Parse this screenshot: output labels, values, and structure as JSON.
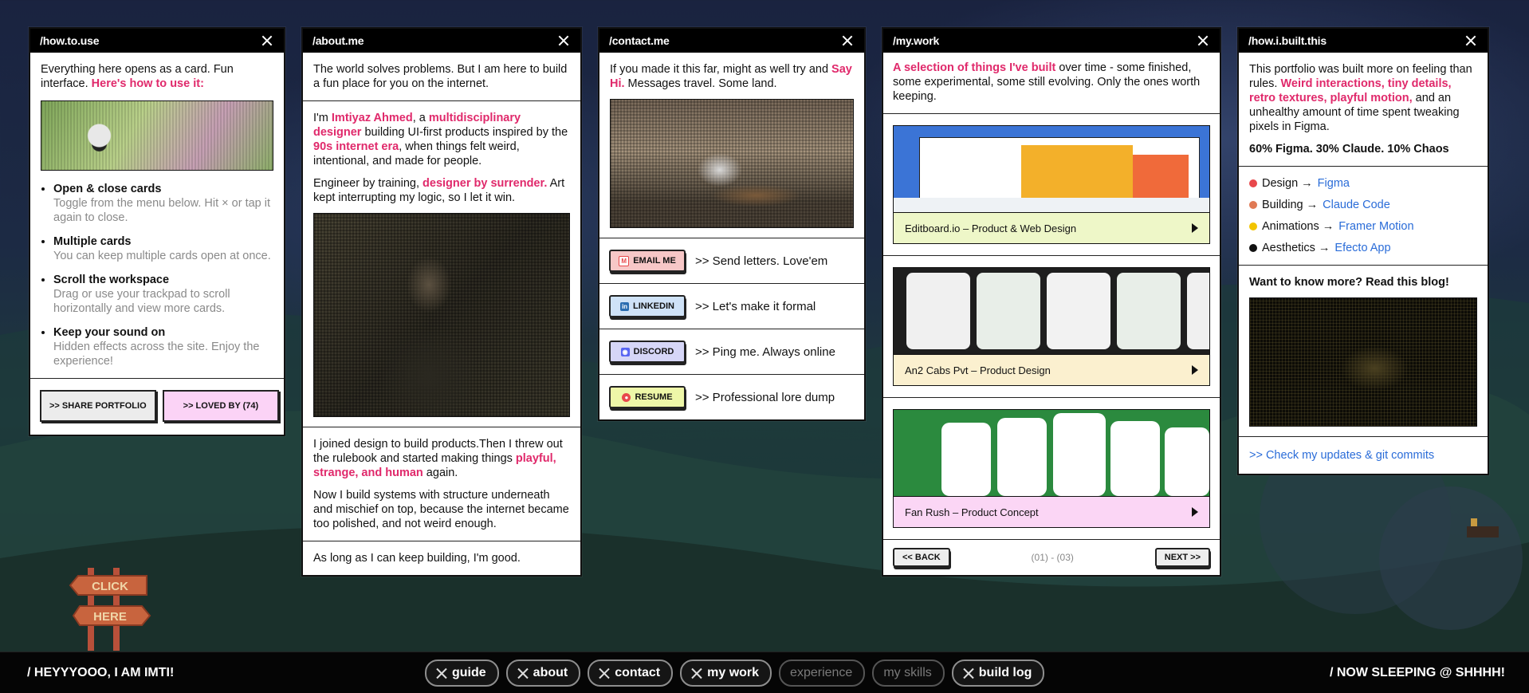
{
  "guide": {
    "title": "/how.to.use",
    "intro": "Everything here opens as a card. Fun interface. ",
    "intro_link": "Here's how to use it:",
    "items": [
      {
        "title": "Open & close cards",
        "desc": "Toggle from the menu below. Hit × or tap it again to close."
      },
      {
        "title": "Multiple cards",
        "desc": "You can keep multiple cards open at once."
      },
      {
        "title": "Scroll the workspace",
        "desc": "Drag or use your trackpad to scroll horizontally and view more cards."
      },
      {
        "title": "Keep your sound on",
        "desc": "Hidden effects across the site. Enjoy the experience!"
      }
    ],
    "share_label": ">> SHARE PORTFOLIO",
    "loved_label": ">> LOVED BY (74)"
  },
  "about": {
    "title": "/about.me",
    "p1": "The world solves problems. But I am here to build a fun place for you on the internet.",
    "p2_a": "I'm ",
    "name": "Imtiyaz Ahmed",
    "p2_b": ", a ",
    "role": "multidisciplinary designer",
    "p2_c": " building UI-first products inspired by the ",
    "era": "90s internet era",
    "p2_d": ", when things felt weird, intentional, and made for people.",
    "p3_a": "Engineer by training, ",
    "p3_link": "designer by surrender.",
    "p3_b": " Art kept interrupting my logic, so I let it win.",
    "p4_a": "I joined design to build products.Then I threw out the rulebook and started making things ",
    "p4_link": "playful, strange, and human",
    "p4_b": " again.",
    "p5": "Now I build systems with structure underneath and mischief on top, because the internet became too polished, and not weird enough.",
    "p6": "As long as I can keep building, I'm good."
  },
  "contact": {
    "title": "/contact.me",
    "intro_a": "If you made it this far, might as well try and ",
    "intro_link": "Say Hi.",
    "intro_b": " Messages travel. Some land.",
    "rows": [
      {
        "label": "EMAIL ME",
        "text": ">> Send letters. Love'em",
        "color": "#f7c7c7",
        "icon_color": "#e8484b",
        "icon": "email-icon",
        "glyph": "M"
      },
      {
        "label": "LINKEDIN",
        "text": ">> Let's make it formal",
        "color": "#cfe2f7",
        "icon_color": "#2a6cb0",
        "icon": "linkedin-icon",
        "glyph": "in"
      },
      {
        "label": "DISCORD",
        "text": ">> Ping me. Always online",
        "color": "#d6d6f7",
        "icon_color": "#5865f2",
        "icon": "discord-icon",
        "glyph": "◉"
      },
      {
        "label": "RESUME",
        "text": ">> Professional lore dump",
        "color": "#eef7a8",
        "icon_color": "#e8484b",
        "icon": "resume-icon",
        "glyph": "●"
      }
    ]
  },
  "work": {
    "title": "/my.work",
    "intro_link": "A selection of things I've built",
    "intro_b": " over time - some finished, some experimental, some still evolving. Only the ones worth keeping.",
    "items": [
      {
        "caption": "Editboard.io – Product & Web Design",
        "cap_color": "#eef7c8",
        "thumb_color": "#3b74d6"
      },
      {
        "caption": "An2 Cabs Pvt – Product Design",
        "cap_color": "#fbf0cf",
        "thumb_color": "#1e1e1e"
      },
      {
        "caption": "Fan Rush – Product Concept",
        "cap_color": "#fbd6f5",
        "thumb_color": "#2b8a3e"
      }
    ],
    "back_label": "<< BACK",
    "page_label": "(01) - (03)",
    "next_label": "NEXT >>"
  },
  "built": {
    "title": "/how.i.built.this",
    "p1_a": "This portfolio was built more on feeling than rules. ",
    "p1_link": "Weird interactions, tiny details, retro textures, playful motion,",
    "p1_b": " and an unhealthy amount of time spent tweaking pixels in Figma.",
    "ratio": "60% Figma. 30% Claude. 10% Chaos",
    "tools": [
      {
        "label": "Design → ",
        "link": "Figma",
        "color": "#e8484b",
        "icon": "figma-icon"
      },
      {
        "label": "Building → ",
        "link": "Claude Code",
        "color": "#e07a55",
        "icon": "claude-icon"
      },
      {
        "label": "Animations → ",
        "link": "Framer Motion",
        "color": "#f2c400",
        "icon": "framer-icon"
      },
      {
        "label": "Aesthetics → ",
        "link": "Efecto App",
        "color": "#111111",
        "icon": "efecto-icon"
      }
    ],
    "blog_heading": "Want to know more? Read this blog!",
    "updates_link": ">> Check my updates & git commits"
  },
  "footer": {
    "left": "/ HEYYYOOO, I AM IMTI!",
    "right": "/ NOW SLEEPING @ SHHHH!",
    "nav": [
      {
        "label": "guide",
        "active": true
      },
      {
        "label": "about",
        "active": true
      },
      {
        "label": "contact",
        "active": true
      },
      {
        "label": "my work",
        "active": true
      },
      {
        "label": "experience",
        "active": false
      },
      {
        "label": "my skills",
        "active": false
      },
      {
        "label": "build log",
        "active": true
      }
    ]
  },
  "sign": {
    "line1": "CLICK",
    "line2": "HERE"
  }
}
